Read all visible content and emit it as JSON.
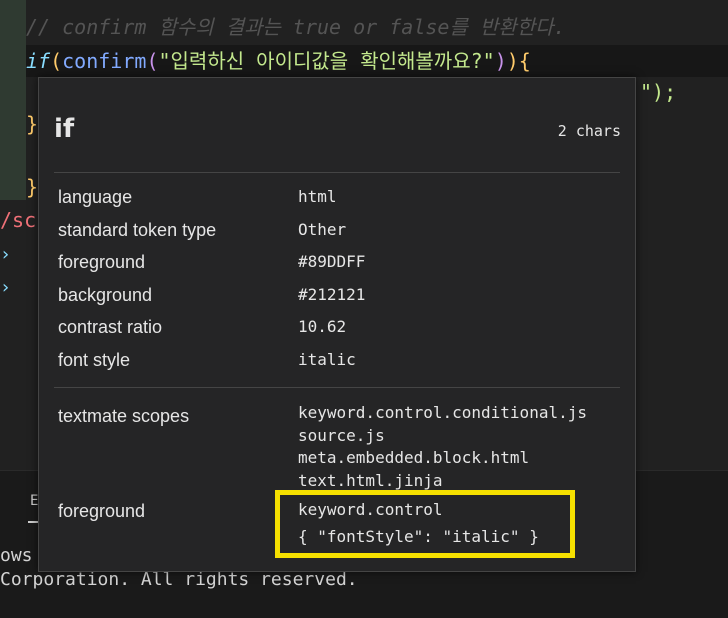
{
  "editor": {
    "comment_line": "// confirm 함수의 결과는 true or false를 반환한다.",
    "if_keyword": "if",
    "open_paren": "(",
    "confirm_fn": "confirm",
    "confirm_open": "(",
    "confirm_string": "\"입력하신 아이디값을 확인해볼까요?\"",
    "confirm_close": ")",
    "close_brace_paren": ")",
    "open_brace": "{",
    "line3_tail": "\");",
    "close_brace_1": "}",
    "close_brace_2": "}",
    "script_fragment": "/scr",
    "chevron_1": "›",
    "chevron_2": "›"
  },
  "terminal": {
    "tab_fragment": "E",
    "line1": "ows",
    "line2": "Corporation. All rights reserved."
  },
  "hover": {
    "token": "if",
    "char_count": "2 chars",
    "rows": [
      {
        "label": "language",
        "value": "html"
      },
      {
        "label": "standard token type",
        "value": "Other"
      },
      {
        "label": "foreground",
        "value": "#89DDFF"
      },
      {
        "label": "background",
        "value": "#212121"
      },
      {
        "label": "contrast ratio",
        "value": "10.62"
      },
      {
        "label": "font style",
        "value": "italic"
      }
    ],
    "scopes_label": "textmate scopes",
    "scopes": [
      "keyword.control.conditional.js",
      "source.js",
      "meta.embedded.block.html",
      "text.html.jinja"
    ],
    "fg_label": "foreground",
    "fg_rule": "keyword.control",
    "fg_rule_style": "{ \"fontStyle\": \"italic\" }"
  },
  "colors": {
    "editor_bg": "#212121",
    "keyword": "#89DDFF",
    "string": "#C3E88D",
    "function": "#82AAFF",
    "highlight_box": "#F5E000"
  }
}
